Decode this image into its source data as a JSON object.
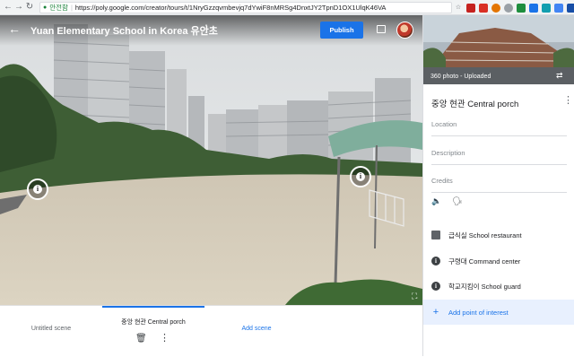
{
  "browser": {
    "secure_label": "안전함",
    "url": "https://poly.google.com/creator/tours/t/1NryGzzqvmbevjq7dYwiF8nMRSg4DnxtJY2TpnD1OX1UlqK46VA"
  },
  "header": {
    "title": "Yuan Elementary School in Korea 유안초",
    "publish_label": "Publish"
  },
  "scenes": {
    "items": [
      {
        "label": "Untitled scene"
      },
      {
        "label": "중앙 현관 Central porch"
      }
    ],
    "add_label": "Add scene"
  },
  "panel": {
    "thumbnail_caption": "360 photo - Uploaded",
    "scene_title": "중앙 현관 Central porch",
    "fields": {
      "location": "Location",
      "description": "Description",
      "credits": "Credits"
    },
    "points_of_interest": [
      {
        "label": "급식실 School restaurant",
        "icon": "image-icon"
      },
      {
        "label": "구령대 Command center",
        "icon": "info-icon"
      },
      {
        "label": "학교지킴이 School guard",
        "icon": "info-icon"
      }
    ],
    "add_poi_label": "Add point of interest"
  },
  "colors": {
    "accent": "#1a73e8",
    "poi_highlight": "#e8f0fe"
  }
}
